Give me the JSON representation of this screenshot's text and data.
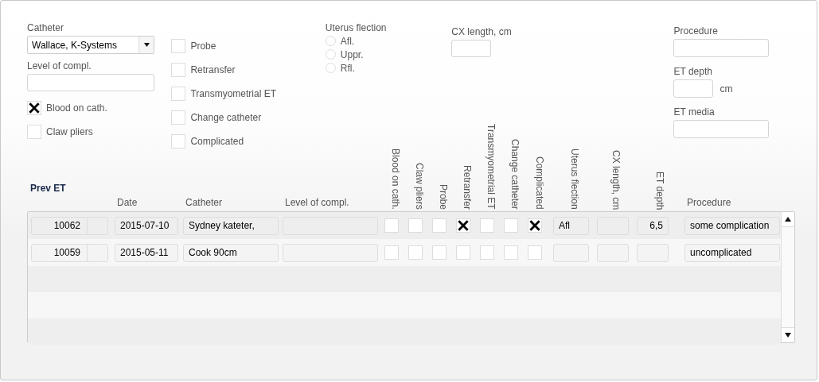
{
  "form": {
    "catheter": {
      "label": "Catheter",
      "value": "Wallace, K-Systems"
    },
    "level_of_compl": {
      "label": "Level of compl."
    },
    "left_checks": [
      {
        "label": "Blood on cath.",
        "checked": true
      },
      {
        "label": "Claw pliers",
        "checked": false
      }
    ],
    "middle_checks": [
      {
        "label": "Probe",
        "checked": false
      },
      {
        "label": "Retransfer",
        "checked": false
      },
      {
        "label": "Transmyometrial ET",
        "checked": false
      },
      {
        "label": "Change catheter",
        "checked": false
      },
      {
        "label": "Complicated",
        "checked": false
      }
    ],
    "uterus_flection": {
      "label": "Uterus flection",
      "options": [
        {
          "label": "Afl.",
          "selected": false
        },
        {
          "label": "Uppr.",
          "selected": false
        },
        {
          "label": "Rfl.",
          "selected": false
        }
      ]
    },
    "cx_length": {
      "label": "CX length, cm"
    },
    "procedure": {
      "label": "Procedure"
    },
    "et_depth": {
      "label": "ET depth",
      "unit": "cm"
    },
    "et_media": {
      "label": "ET media"
    }
  },
  "table": {
    "title": "Prev ET",
    "columns": [
      {
        "label": "Date",
        "kind": "text"
      },
      {
        "label": "Catheter",
        "kind": "text"
      },
      {
        "label": "Level of compl.",
        "kind": "text"
      },
      {
        "label": "Blood on cath.",
        "kind": "check"
      },
      {
        "label": "Claw pliers",
        "kind": "check"
      },
      {
        "label": "Probe",
        "kind": "check"
      },
      {
        "label": "Retransfer",
        "kind": "check"
      },
      {
        "label": "Transmyometrial ET",
        "kind": "check"
      },
      {
        "label": "Change catheter",
        "kind": "check"
      },
      {
        "label": "Complicated",
        "kind": "check"
      },
      {
        "label": "Uterus flection",
        "kind": "vertical"
      },
      {
        "label": "CX length, cm",
        "kind": "vertical"
      },
      {
        "label": "ET depth",
        "kind": "vertical"
      },
      {
        "label": "Procedure",
        "kind": "text"
      }
    ],
    "rows": [
      {
        "id": "10062",
        "date": "2015-07-10",
        "catheter": "Sydney kateter,",
        "checks": [
          false,
          false,
          false,
          true,
          false,
          false,
          true
        ],
        "uterus_flection": "Afl",
        "et_depth": "6,5",
        "procedure": "some complication"
      },
      {
        "id": "10059",
        "date": "2015-05-11",
        "catheter": "Cook 90cm",
        "checks": [
          false,
          false,
          false,
          false,
          false,
          false,
          false
        ],
        "procedure": "uncomplicated"
      }
    ]
  }
}
